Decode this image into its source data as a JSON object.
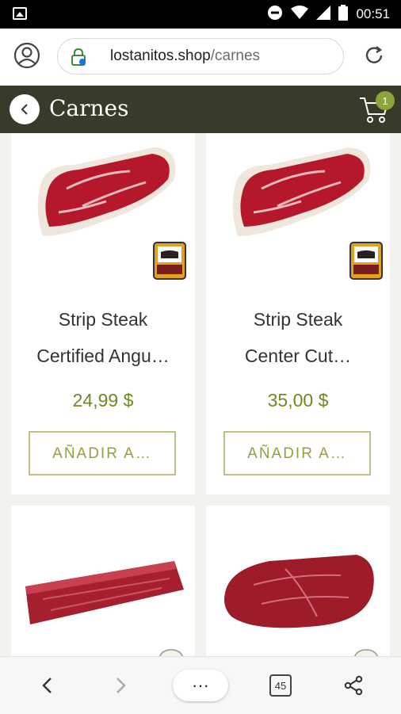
{
  "status_bar": {
    "time": "00:51"
  },
  "browser": {
    "url_domain": "lostanitos.shop",
    "url_path": "/carnes"
  },
  "header": {
    "title": "Carnes",
    "cart_count": "1"
  },
  "products": [
    {
      "name_line1": "Strip Steak",
      "name_line2": "Certified Angu…",
      "price": "24,99 $",
      "button": "AÑADIR A…"
    },
    {
      "name_line1": "Strip Steak",
      "name_line2": "Center Cut…",
      "price": "35,00 $",
      "button": "AÑADIR A…"
    }
  ],
  "bottom_nav": {
    "more": "···",
    "tab_count": "45"
  }
}
